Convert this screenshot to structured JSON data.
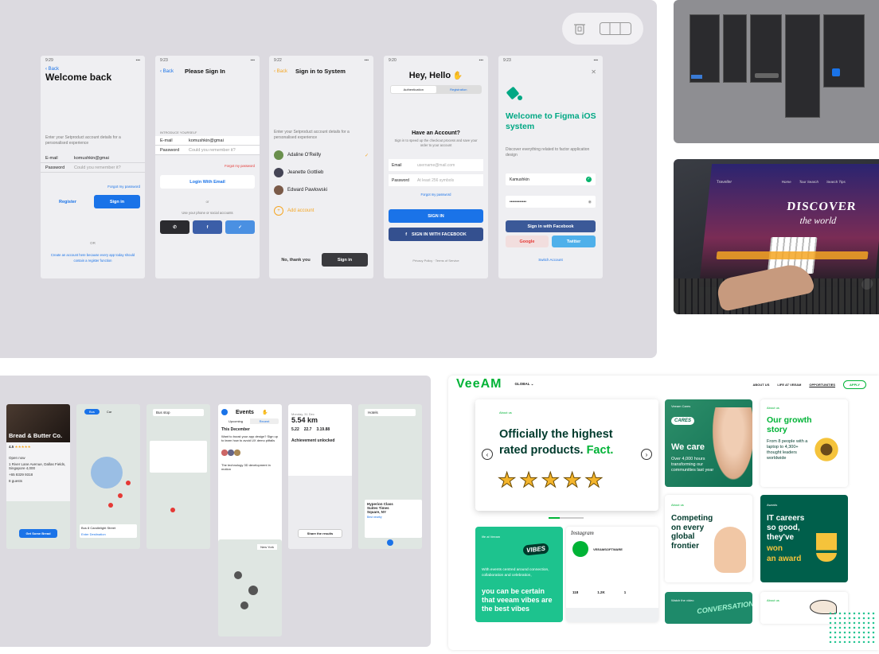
{
  "toolbar": {
    "delete_icon": "trash-icon",
    "layout_icon": "columns-icon"
  },
  "screens": [
    {
      "time": "9:29",
      "back": "Back",
      "title": "Welcome back",
      "desc": "Enter your Setproduct account details for a personalised experience",
      "email_label": "E-mail",
      "email_value": "komushkin@gmai",
      "password_label": "Password",
      "password_placeholder": "Could you remember it?",
      "forgot": "Forgot my password",
      "register": "Register",
      "signin": "Sign in",
      "or": "OR",
      "footer": "Create an account here because every app today should contain a register function"
    },
    {
      "time": "9:23",
      "back": "Back",
      "title": "Please Sign In",
      "section": "INTRODUCE YOURSELF",
      "email_label": "E-mail",
      "email_value": "komushkin@gmai",
      "password_label": "Password",
      "password_placeholder": "Could you remember it?",
      "forgot": "Forgot my password",
      "login": "Login With Email",
      "or": "or",
      "alt": "Use your phone or social accounts"
    },
    {
      "time": "9:22",
      "back": "Back",
      "title": "Sign in to System",
      "desc": "Enter your Setproduct account details for a personalised experience",
      "accounts": [
        "Adaline O'Reilly",
        "Jeanette Gottlieb",
        "Edward Pawlowski"
      ],
      "add": "Add account",
      "no": "No, thank you",
      "signin": "Sign in"
    },
    {
      "time": "9:20",
      "title": "Hey, Hello",
      "tab1": "Authentication",
      "tab2": "Registration",
      "heading": "Have an Account?",
      "desc": "Sign in to speed up the checkout process and save your order to your account",
      "email_label": "Email",
      "email_placeholder": "username@mail.com",
      "password_label": "Password",
      "password_placeholder": "At least 256 symbols",
      "forgot": "Forgot my password",
      "signin": "SIGN IN",
      "facebook": "SIGN IN WITH FACEBOOK",
      "footer": "Privacy Policy · Terms of Service"
    },
    {
      "time": "9:23",
      "title": "Welcome to Figma iOS system",
      "desc": "Discover everything related to factor application design",
      "user": "Kamushkin",
      "password": "••••••••••••",
      "facebook": "Sign in with Facebook",
      "google": "Google",
      "twitter": "Twitter",
      "switch": "Switch Account"
    }
  ],
  "laptop": {
    "title": "DISCOVER",
    "subtitle": "the world",
    "brand": "Traveller",
    "nav": [
      "Home",
      "Tour Search",
      "Search Tips"
    ]
  },
  "mobile_apps": {
    "restaurant": {
      "name": "Bread & Butter Co.",
      "rating": "4.5",
      "details": [
        "Open now",
        "1 River Lane Avenue, Dallas Fields, Singapore 4,000",
        "+65 8329 9318",
        "8 guests"
      ],
      "cta": "Get Some Bread"
    },
    "map_tabs": [
      "Bus",
      "Car"
    ],
    "map_list": [
      "Bus 8 Candlelight Street",
      "Enter Destination"
    ],
    "search_placeholder": "Bus stop",
    "events": {
      "title": "Events",
      "tabs": [
        "Upcoming",
        "Recent"
      ],
      "date": "This December",
      "p1": "Want to boost your app design? Sign up to learn how to avoid UX demo pitfalls",
      "p2": "The technology 3D development in motion"
    },
    "running": {
      "date": "Monday, 31 Dec",
      "distance": "5.54 km",
      "stats": [
        "5.22",
        "22.7",
        "3.19.88"
      ],
      "achievement": "Achievement unlocked",
      "cta": "Share the results"
    },
    "hotel": {
      "search": "Hotels",
      "name": "Hyperion Class Suites Times Square, NY",
      "tag": "Best nearby"
    },
    "city": "New York"
  },
  "veeam": {
    "logo": "VeeAM",
    "region": "GLOBAL",
    "nav": [
      "ABOUT US",
      "LIFE AT VEEAM",
      "OPPORTUNITIES"
    ],
    "apply": "APPLY",
    "hero_tag": "About us",
    "hero_title": "Officially the highest",
    "hero_title2": "rated products.",
    "hero_fact": "Fact.",
    "care_tag": "Veeam Cares",
    "care_badge": "CARES",
    "care_title": "We care",
    "care_text": "Over 4,000 hours transforming our communities last year",
    "growth_tag": "About us",
    "growth_title": "Our growth story",
    "growth_text": "From 8 people with a laptop to 4,300+ thought leaders worldwide",
    "compete_tag": "About us",
    "compete_title": "Competing on every global frontier",
    "careers_tag": "Awards",
    "careers_title": "IT careers so good, they've",
    "careers_won": "won",
    "careers_award": "an award",
    "vibes_tag": "life at Veeam",
    "vibes_badge": "VIBES",
    "vibes_text": "With events centred around connection, collaboration and celebration,",
    "vibes_title": "you can be certain that veeam vibes are the best vibes",
    "insta": "Instagram",
    "insta_name": "VEEAMSOFTWARE",
    "insta_stats": [
      "118",
      "1.2K",
      "1"
    ],
    "video_tag": "Watch the video",
    "video_word": "CONVERSATIONS",
    "small_tag": "About us"
  },
  "colors": {
    "accent": "#1a73e8",
    "veeam_green": "#00b336",
    "veeam_dark": "#005f4b",
    "panel_bg": "#dcdae0"
  }
}
